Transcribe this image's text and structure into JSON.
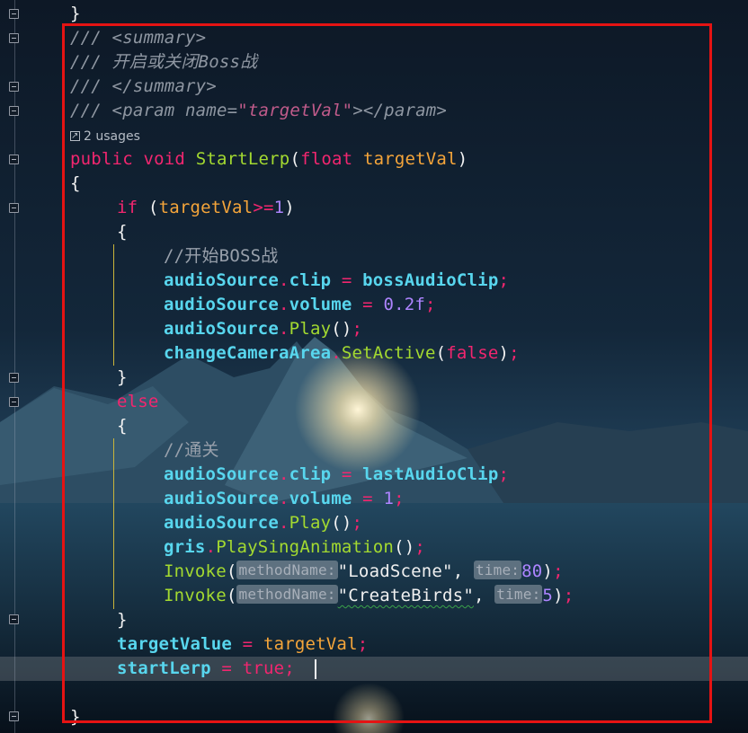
{
  "editor": {
    "lines": {
      "close_brace_top": "}",
      "doc_summary_open": "/// <summary>",
      "doc_summary_text": "/// 开启或关闭Boss战",
      "doc_summary_close": "/// </summary>",
      "doc_param_prefix": "/// <param name=",
      "doc_param_value": "\"targetVal\"",
      "doc_param_suffix": "></param>",
      "usages": "2 usages",
      "kw_public": "public",
      "kw_void": "void",
      "method_name": "StartLerp",
      "kw_float": "float",
      "param_name": "targetVal",
      "open_brace": "{",
      "close_brace": "}",
      "kw_if": "if",
      "cond_var": "targetVal",
      "cond_op": ">=",
      "cond_num": "1",
      "comment_start_boss": "//开始BOSS战",
      "audio_source": "audioSource",
      "member_clip": "clip",
      "boss_clip": "bossAudioClip",
      "member_volume": "volume",
      "vol_boss": "0.2f",
      "member_play": "Play",
      "change_camera": "changeCameraArea",
      "set_active": "SetActive",
      "kw_false": "false",
      "kw_else": "else",
      "comment_pass": "//通关",
      "last_clip": "lastAudioClip",
      "vol_last": "1",
      "gris": "gris",
      "play_sing": "PlaySingAnimation",
      "invoke": "Invoke",
      "hint_method_name": "methodName:",
      "load_scene": "\"LoadScene\"",
      "hint_time": "time:",
      "time_80": "80",
      "create_birds": "\"CreateBirds\"",
      "time_5": "5",
      "target_value": "targetValue",
      "start_lerp": "startLerp",
      "kw_true": "true"
    }
  },
  "colors": {
    "keyword": "#f2266f",
    "function": "#a3d930",
    "member": "#58d6ee",
    "number": "#ad84ff",
    "highlight_box": "#e51313"
  }
}
